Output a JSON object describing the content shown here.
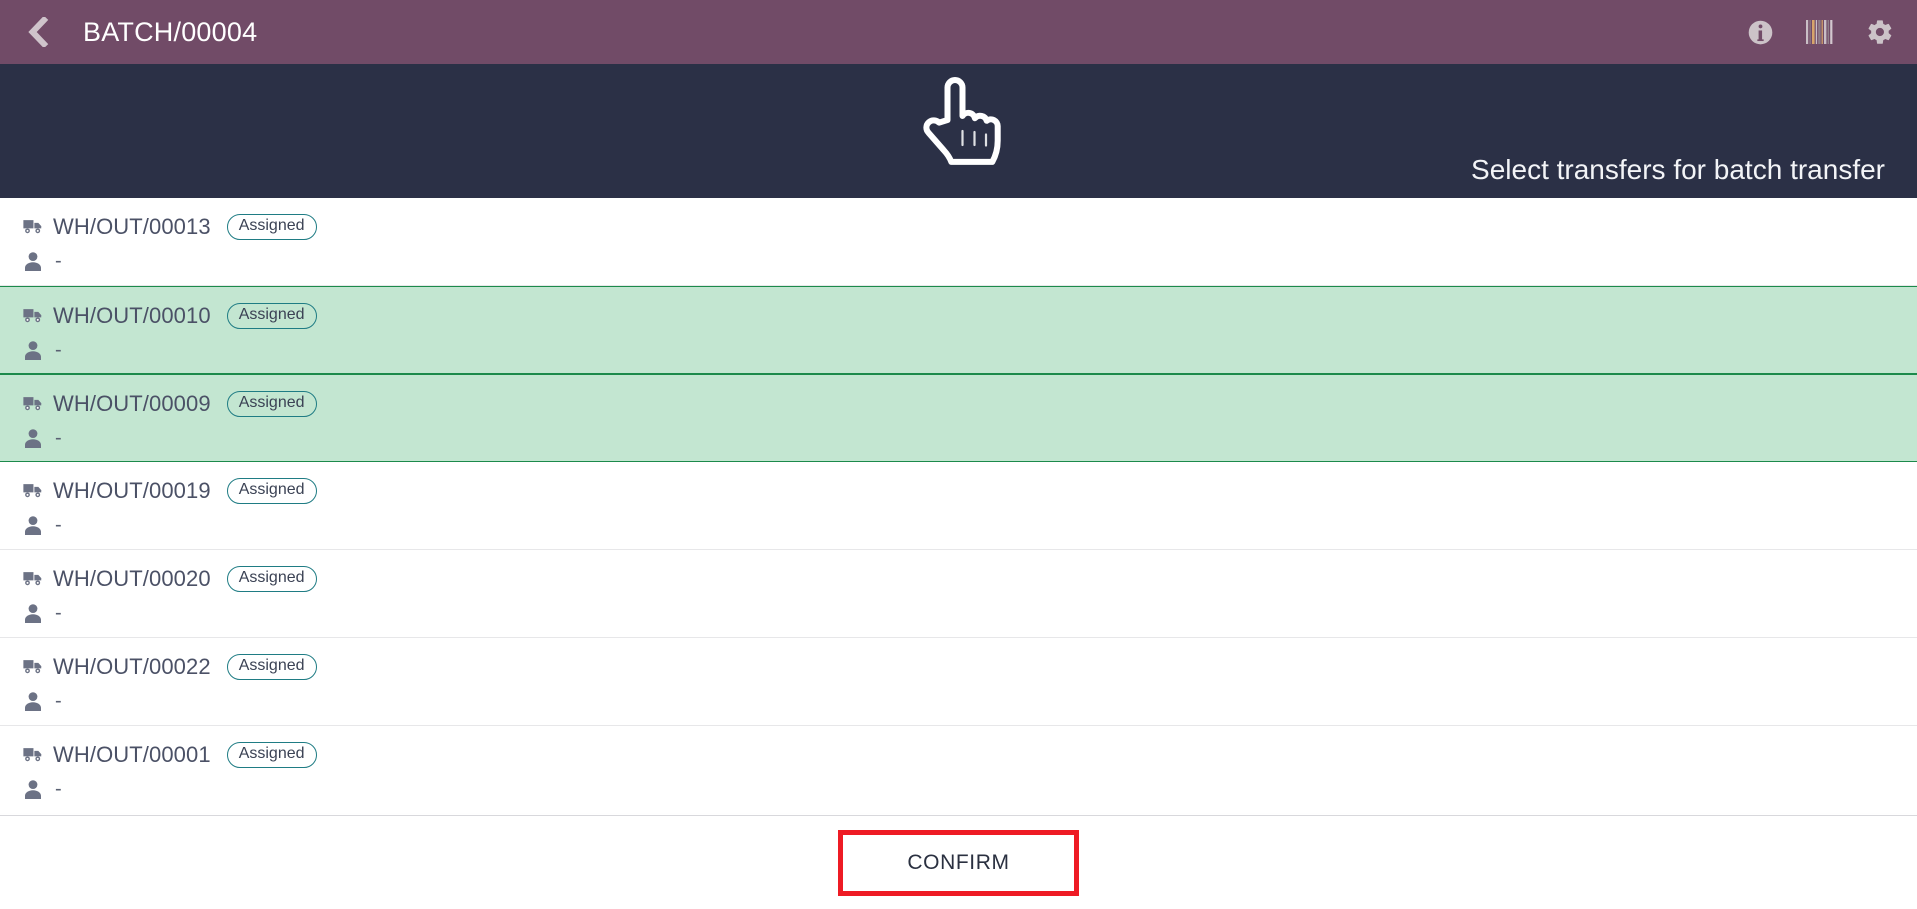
{
  "appbar": {
    "title": "BATCH/00004",
    "back_icon": "chevron-left-icon",
    "actions": [
      {
        "name": "info-icon",
        "label": "Information"
      },
      {
        "name": "barcode-icon",
        "label": "Barcode"
      },
      {
        "name": "gear-icon",
        "label": "Settings"
      }
    ]
  },
  "banner": {
    "hand_icon": "pointing-hand-icon",
    "instruction": "Select transfers for batch transfer"
  },
  "list": {
    "truck_icon": "truck-icon",
    "person_icon": "person-icon",
    "rows": [
      {
        "reference": "WH/OUT/00013",
        "status": "Assigned",
        "person": "-",
        "selected": false
      },
      {
        "reference": "WH/OUT/00010",
        "status": "Assigned",
        "person": "-",
        "selected": true
      },
      {
        "reference": "WH/OUT/00009",
        "status": "Assigned",
        "person": "-",
        "selected": true
      },
      {
        "reference": "WH/OUT/00019",
        "status": "Assigned",
        "person": "-",
        "selected": false
      },
      {
        "reference": "WH/OUT/00020",
        "status": "Assigned",
        "person": "-",
        "selected": false
      },
      {
        "reference": "WH/OUT/00022",
        "status": "Assigned",
        "person": "-",
        "selected": false
      },
      {
        "reference": "WH/OUT/00001",
        "status": "Assigned",
        "person": "-",
        "selected": false
      }
    ]
  },
  "footer": {
    "confirm_label": "CONFIRM"
  },
  "colors": {
    "appbar_bg": "#714B67",
    "banner_bg": "#2B3046",
    "selected_row_bg": "#C3E6D1",
    "selected_row_border": "#1C8A4B",
    "badge_border": "#1F7C84",
    "highlight": "#EE1B24",
    "text_primary": "#4B5166"
  }
}
